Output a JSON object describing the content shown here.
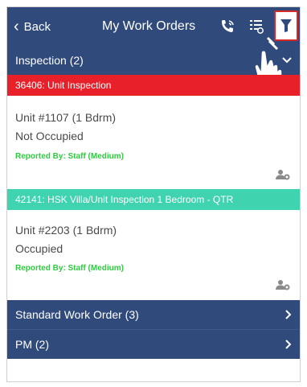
{
  "header": {
    "back_label": "Back",
    "title": "My Work Orders",
    "icons": [
      "phone-icon",
      "checklist-icon",
      "filter-icon"
    ]
  },
  "inspection_group": {
    "label": "Inspection (2)"
  },
  "work_orders": [
    {
      "header": "36406: Unit Inspection",
      "header_color": "#e8202a",
      "unit": "Unit #1107 (1 Bdrm)",
      "occupancy": "Not Occupied",
      "reported_by": "Reported By: Staff  (Medium)"
    },
    {
      "header": "42141: HSK Villa/Unit Inspection 1 Bedroom - QTR",
      "header_color": "#3fd3b0",
      "unit": "Unit #2203 (1 Bdrm)",
      "occupancy": "Occupied",
      "reported_by": "Reported By: Staff  (Medium)"
    }
  ],
  "groups": [
    {
      "label": "Standard Work Order (3)"
    },
    {
      "label": "PM (2)"
    }
  ],
  "colors": {
    "brand_navy": "#2f4a7b",
    "alert_red": "#e8202a",
    "teal": "#3fd3b0",
    "reported_green": "#2ecc40"
  }
}
